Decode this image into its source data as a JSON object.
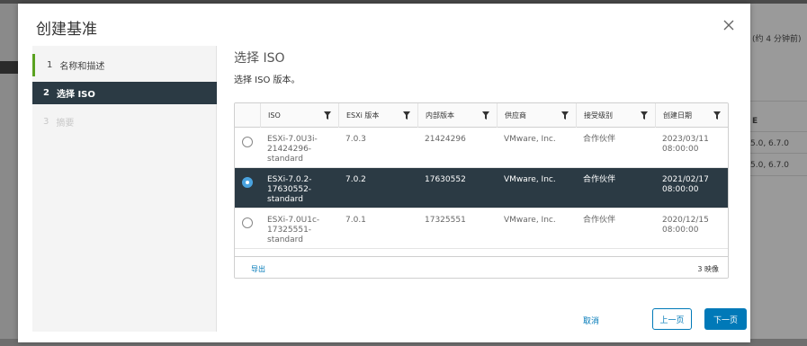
{
  "background": {
    "right_header": "(约 4 分钟前)",
    "right_col_label": "E",
    "right_rows": [
      "5.0, 6.7.0",
      "5.0, 6.7.0"
    ]
  },
  "modal": {
    "title": "创建基准",
    "close_icon": "close-icon"
  },
  "steps": [
    {
      "number": "1",
      "label": "名称和描述",
      "state": "done"
    },
    {
      "number": "2",
      "label": "选择 ISO",
      "state": "active"
    },
    {
      "number": "3",
      "label": "摘要",
      "state": "disabled"
    }
  ],
  "content": {
    "title": "选择 ISO",
    "subtitle": "选择 ISO 版本。"
  },
  "grid": {
    "columns": [
      "ISO",
      "ESXi 版本",
      "内部版本",
      "供应商",
      "接受级别",
      "创建日期"
    ],
    "rows": [
      {
        "iso": "ESXi-7.0U3i-\n21424296-\nstandard",
        "esxi": "7.0.3",
        "build": "21424296",
        "vendor": "VMware, Inc.",
        "level": "合作伙伴",
        "date": "2023/03/11\n08:00:00",
        "selected": false
      },
      {
        "iso": "ESXi-7.0.2-\n17630552-\nstandard",
        "esxi": "7.0.2",
        "build": "17630552",
        "vendor": "VMware, Inc.",
        "level": "合作伙伴",
        "date": "2021/02/17\n08:00:00",
        "selected": true
      },
      {
        "iso": "ESXi-7.0U1c-\n17325551-\nstandard",
        "esxi": "7.0.1",
        "build": "17325551",
        "vendor": "VMware, Inc.",
        "level": "合作伙伴",
        "date": "2020/12/15\n08:00:00",
        "selected": false
      }
    ],
    "export_label": "导出",
    "count_label": "3 映像"
  },
  "footer": {
    "cancel": "取消",
    "prev": "上一页",
    "next": "下一页"
  },
  "colors": {
    "accent": "#0079b8",
    "selected_row": "#2b3a44",
    "step_done": "#5aa220"
  }
}
